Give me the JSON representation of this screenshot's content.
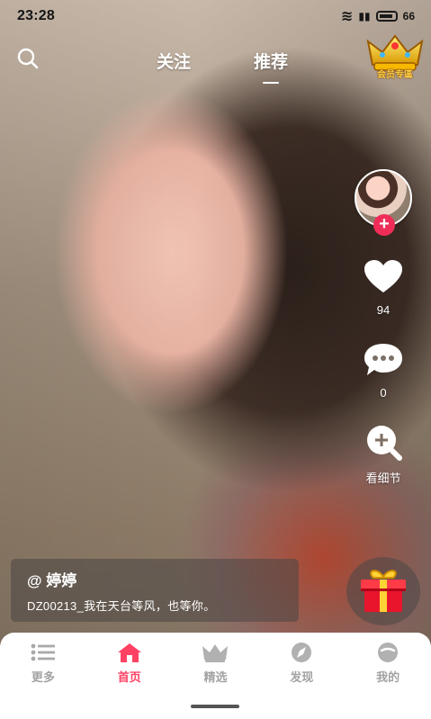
{
  "status_bar": {
    "time": "23:28",
    "battery_level": "66"
  },
  "top_nav": {
    "tabs": [
      {
        "label": "关注",
        "active": false
      },
      {
        "label": "推荐",
        "active": true
      }
    ],
    "vip_label": "会员专區"
  },
  "actions": {
    "follow_symbol": "+",
    "like_count": "94",
    "comment_count": "0",
    "detail_label": "看细节"
  },
  "caption": {
    "author": "@ 婷婷",
    "text": "DZ00213_我在天台等风，也等你。"
  },
  "bottom_nav": {
    "items": [
      {
        "label": "更多",
        "icon": "list-icon",
        "active": false
      },
      {
        "label": "首页",
        "icon": "home-icon",
        "active": true
      },
      {
        "label": "精选",
        "icon": "crown-icon",
        "active": false
      },
      {
        "label": "发现",
        "icon": "compass-icon",
        "active": false
      },
      {
        "label": "我的",
        "icon": "face-icon",
        "active": false
      }
    ]
  },
  "colors": {
    "accent": "#ff4264",
    "follow": "#ef2d58",
    "inactive_nav": "#a3a3a3"
  }
}
